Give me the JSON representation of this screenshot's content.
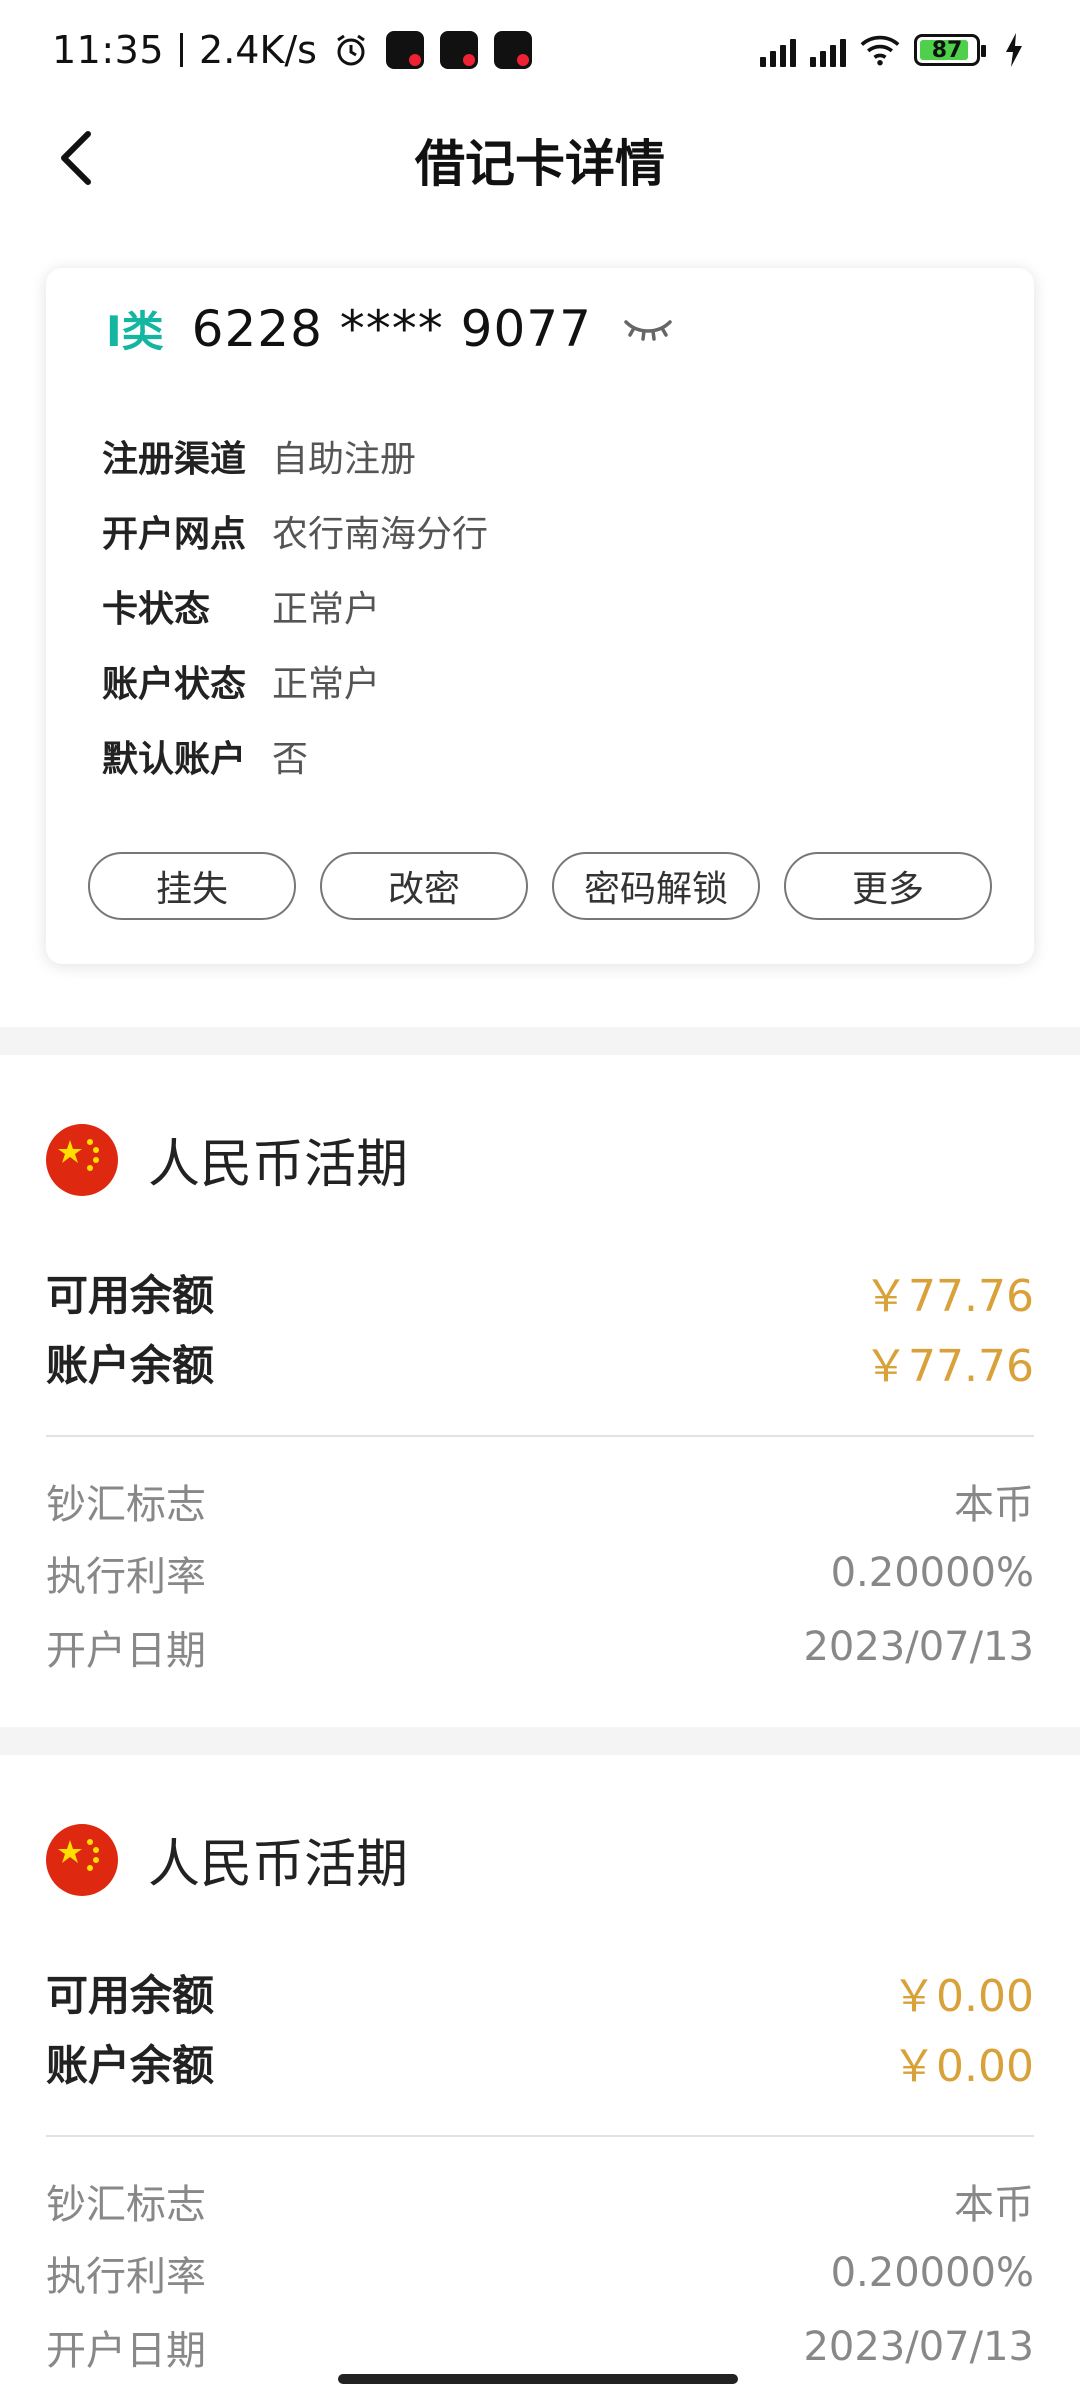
{
  "status_bar": {
    "time": "11:35",
    "net_speed": "2.4K/s",
    "battery": "87"
  },
  "header": {
    "title": "借记卡详情"
  },
  "card": {
    "type": "I类",
    "number": "6228 **** 9077",
    "info": [
      {
        "label": "注册渠道",
        "value": "自助注册"
      },
      {
        "label": "开户网点",
        "value": "农行南海分行"
      },
      {
        "label": "卡状态",
        "value": "正常户"
      },
      {
        "label": "账户状态",
        "value": "正常户"
      },
      {
        "label": "默认账户",
        "value": "否"
      }
    ],
    "actions": [
      "挂失",
      "改密",
      "密码解锁",
      "更多"
    ]
  },
  "accounts": [
    {
      "name": "人民币活期",
      "available_label": "可用余额",
      "available": "￥77.76",
      "balance_label": "账户余额",
      "balance": "￥77.76",
      "meta": [
        {
          "label": "钞汇标志",
          "value": "本币"
        },
        {
          "label": "执行利率",
          "value": "0.20000%"
        },
        {
          "label": "开户日期",
          "value": "2023/07/13"
        }
      ]
    },
    {
      "name": "人民币活期",
      "available_label": "可用余额",
      "available": "￥0.00",
      "balance_label": "账户余额",
      "balance": "￥0.00",
      "meta": [
        {
          "label": "钞汇标志",
          "value": "本币"
        },
        {
          "label": "执行利率",
          "value": "0.20000%"
        },
        {
          "label": "开户日期",
          "value": "2023/07/13"
        }
      ]
    }
  ],
  "colors": {
    "accent_teal": "#13b6a0",
    "amount_gold": "#d9a13a",
    "flag_red": "#de2910",
    "flag_yellow": "#ffde00"
  }
}
